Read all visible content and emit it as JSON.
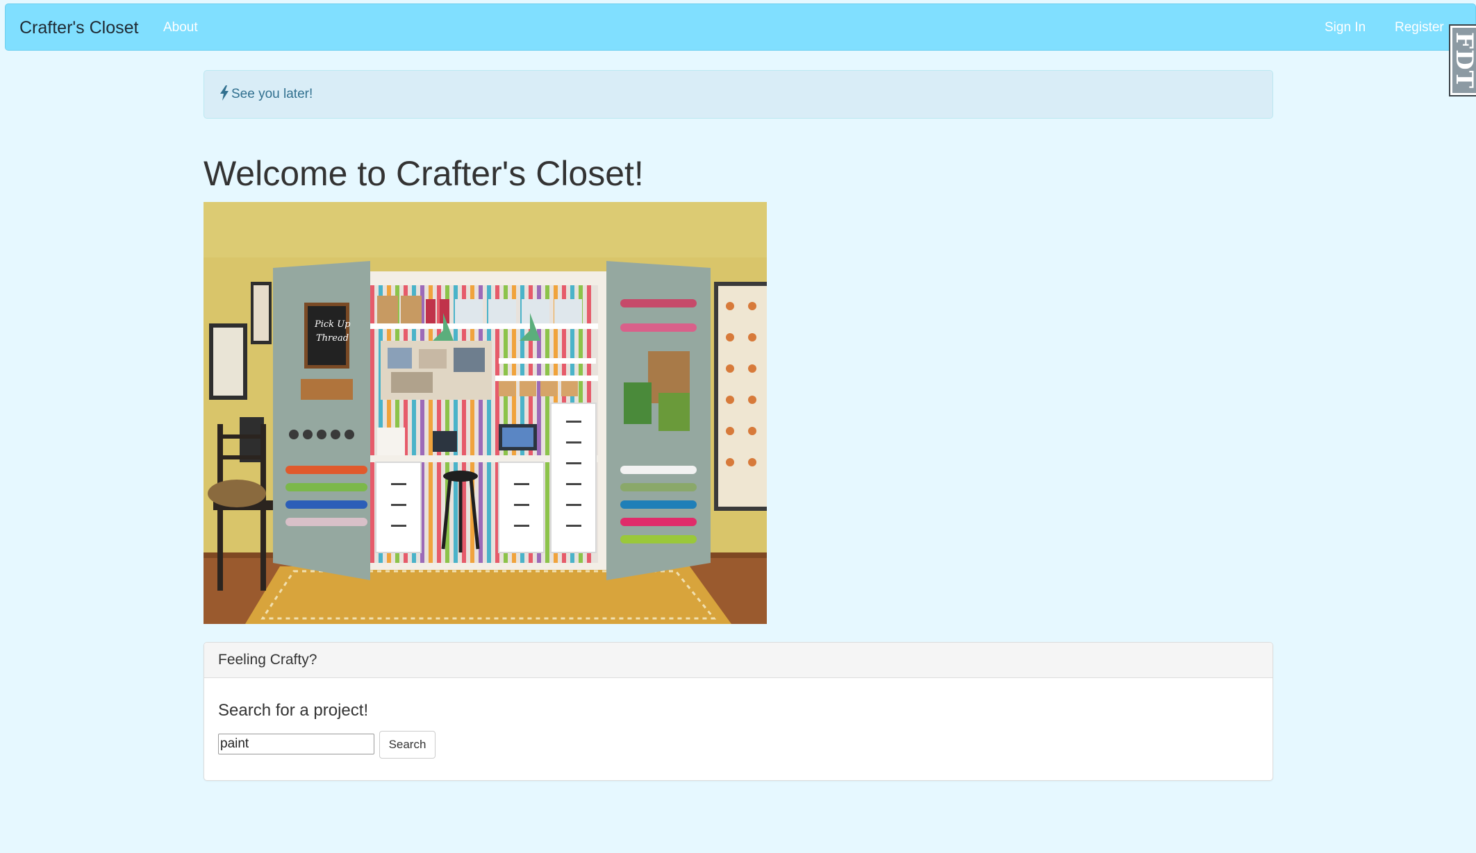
{
  "navbar": {
    "brand": "Crafter's Closet",
    "about": "About",
    "sign_in": "Sign In",
    "register": "Register",
    "background": "#80dfff"
  },
  "badge": {
    "text": "FDT"
  },
  "flash": {
    "icon": "bolt-icon",
    "message": "See you later!"
  },
  "main": {
    "title": "Welcome to Crafter's Closet!",
    "hero_icon": "craft-closet-photo"
  },
  "panel": {
    "heading": "Feeling Crafty?",
    "search_label": "Search for a project!",
    "search_value": "paint",
    "search_button": "Search"
  },
  "colors": {
    "page_background": "#e6f8ff",
    "alert_background": "#d9edf7",
    "alert_text": "#31708f"
  }
}
